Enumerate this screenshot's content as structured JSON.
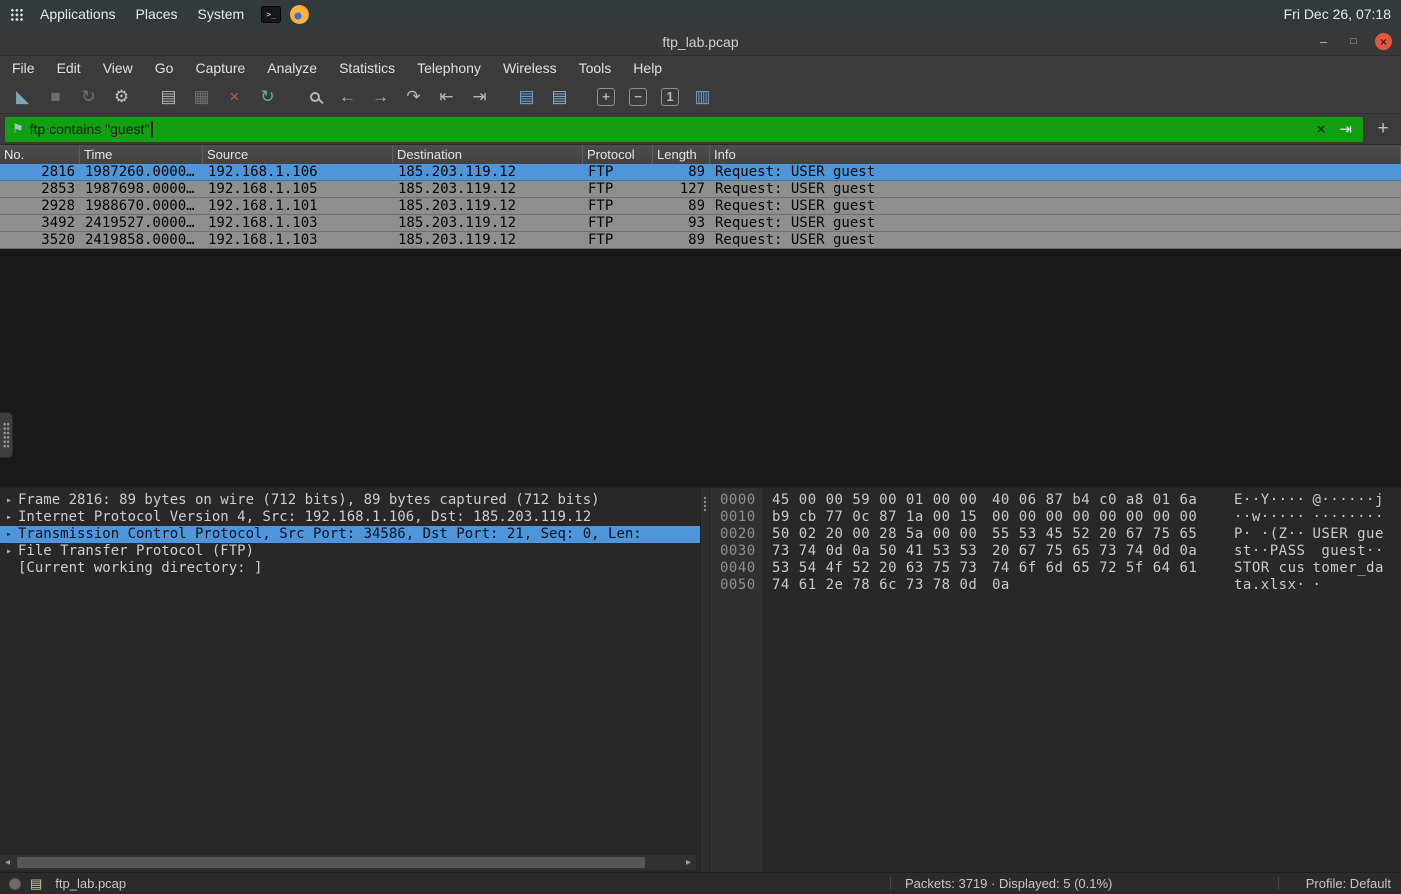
{
  "colors": {
    "filter_valid_bg": "#12a012",
    "selection_blue": "#4f95d9",
    "row_gray": "#8e8e8e",
    "close_button_orange": "#e2573d"
  },
  "panel": {
    "menus": [
      "Applications",
      "Places",
      "System"
    ],
    "launchers": [
      {
        "name": "terminal-launcher-icon",
        "glyph": ">_"
      }
    ],
    "clock": "Fri Dec 26, 07:18"
  },
  "titlebar": {
    "title": "ftp_lab.pcap",
    "buttons": [
      {
        "name": "minimize-button",
        "glyph": "–"
      },
      {
        "name": "restore-button",
        "glyph": "□"
      },
      {
        "name": "close-button",
        "glyph": "×"
      }
    ]
  },
  "menubar": {
    "items": [
      "File",
      "Edit",
      "View",
      "Go",
      "Capture",
      "Analyze",
      "Statistics",
      "Telephony",
      "Wireless",
      "Tools",
      "Help"
    ]
  },
  "toolbar": {
    "groups": [
      [
        {
          "name": "start-capture-icon",
          "glyph": "◣",
          "color": "#7fa8b8"
        },
        {
          "name": "stop-capture-icon",
          "glyph": "■",
          "color": "#6f6f6f"
        },
        {
          "name": "restart-capture-icon",
          "glyph": "↻",
          "color": "#6f6f6f"
        },
        {
          "name": "capture-options-icon",
          "glyph": "⚙",
          "color": "#b9bec2"
        }
      ],
      [
        {
          "name": "open-file-icon",
          "glyph": "▤",
          "color": "#b0b4b8"
        },
        {
          "name": "save-file-icon",
          "glyph": "▦",
          "color": "#6f6f6f"
        },
        {
          "name": "close-file-icon",
          "glyph": "×",
          "color": "#c85a50"
        },
        {
          "name": "reload-file-icon",
          "glyph": "↻",
          "color": "#5faf9f"
        }
      ],
      [
        {
          "name": "find-packet-icon",
          "shape": "magnifier",
          "color": "#b5b5b5"
        },
        {
          "name": "go-back-icon",
          "glyph": "←",
          "color": "#b5b5b5"
        },
        {
          "name": "go-forward-icon",
          "glyph": "→",
          "color": "#b5b5b5"
        },
        {
          "name": "go-to-packet-icon",
          "glyph": "↷",
          "color": "#b5b5b5"
        },
        {
          "name": "previous-packet-icon",
          "glyph": "⇤",
          "color": "#b5b5b5"
        },
        {
          "name": "next-packet-icon",
          "glyph": "⇥",
          "color": "#b5b5b5"
        }
      ],
      [
        {
          "name": "auto-scroll-icon",
          "glyph": "▤",
          "color": "#6d9fd0"
        },
        {
          "name": "colorize-packets-icon",
          "glyph": "▤",
          "color": "#7fb0d8"
        }
      ],
      [
        {
          "name": "zoom-in-icon",
          "glyph": "+",
          "color": "#b5b5b5",
          "boxed": true
        },
        {
          "name": "zoom-out-icon",
          "glyph": "−",
          "color": "#b5b5b5",
          "boxed": true
        },
        {
          "name": "normal-size-icon",
          "glyph": "1",
          "color": "#b5b5b5",
          "boxed": true
        },
        {
          "name": "resize-columns-icon",
          "glyph": "▥",
          "color": "#6d9fd0"
        }
      ]
    ]
  },
  "filter": {
    "bookmark_glyph": "⚑",
    "value": "ftp contains \"guest\"",
    "clear_glyph": "×",
    "apply_glyph": "⇥",
    "add_label": "+"
  },
  "packet_list": {
    "columns": [
      "No.",
      "Time",
      "Source",
      "Destination",
      "Protocol",
      "Length",
      "Info"
    ],
    "rows": [
      {
        "no": "2816",
        "time": "1987260.0000…",
        "source": "192.168.1.106",
        "destination": "185.203.119.12",
        "protocol": "FTP",
        "length": "89",
        "info": "Request: USER guest",
        "selected": true
      },
      {
        "no": "2853",
        "time": "1987698.0000…",
        "source": "192.168.1.105",
        "destination": "185.203.119.12",
        "protocol": "FTP",
        "length": "127",
        "info": "Request: USER guest",
        "selected": false
      },
      {
        "no": "2928",
        "time": "1988670.0000…",
        "source": "192.168.1.101",
        "destination": "185.203.119.12",
        "protocol": "FTP",
        "length": "89",
        "info": "Request: USER guest",
        "selected": false
      },
      {
        "no": "3492",
        "time": "2419527.0000…",
        "source": "192.168.1.103",
        "destination": "185.203.119.12",
        "protocol": "FTP",
        "length": "93",
        "info": "Request: USER guest",
        "selected": false
      },
      {
        "no": "3520",
        "time": "2419858.0000…",
        "source": "192.168.1.103",
        "destination": "185.203.119.12",
        "protocol": "FTP",
        "length": "89",
        "info": "Request: USER guest",
        "selected": false
      }
    ]
  },
  "details": {
    "expander_glyph": "▸",
    "lines": [
      {
        "text": "Frame 2816: 89 bytes on wire (712 bits), 89 bytes captured (712 bits)",
        "expander": true,
        "selected": false
      },
      {
        "text": "Internet Protocol Version 4, Src: 192.168.1.106, Dst: 185.203.119.12",
        "expander": true,
        "selected": false
      },
      {
        "text": "Transmission Control Protocol, Src Port: 34586, Dst Port: 21, Seq: 0, Len: ",
        "expander": true,
        "selected": true
      },
      {
        "text": "File Transfer Protocol (FTP)",
        "expander": true,
        "selected": false
      },
      {
        "text": "[Current working directory: ]",
        "expander": false,
        "selected": false
      }
    ]
  },
  "hex_dump": {
    "rows": [
      {
        "offset": "0000",
        "hex": [
          "45 00 00 59 00 01 00 00",
          "40 06 87 b4 c0 a8 01 6a"
        ],
        "ascii": [
          "E··Y····",
          "@······j"
        ]
      },
      {
        "offset": "0010",
        "hex": [
          "b9 cb 77 0c 87 1a 00 15",
          "00 00 00 00 00 00 00 00"
        ],
        "ascii": [
          "··w·····",
          "········"
        ]
      },
      {
        "offset": "0020",
        "hex": [
          "50 02 20 00 28 5a 00 00",
          "55 53 45 52 20 67 75 65"
        ],
        "ascii": [
          "P· ·(Z··",
          "USER gue"
        ]
      },
      {
        "offset": "0030",
        "hex": [
          "73 74 0d 0a 50 41 53 53",
          "20 67 75 65 73 74 0d 0a"
        ],
        "ascii": [
          "st··PASS",
          " guest··"
        ]
      },
      {
        "offset": "0040",
        "hex": [
          "53 54 4f 52 20 63 75 73",
          "74 6f 6d 65 72 5f 64 61"
        ],
        "ascii": [
          "STOR cus",
          "tomer_da"
        ]
      },
      {
        "offset": "0050",
        "hex": [
          "74 61 2e 78 6c 73 78 0d",
          "0a"
        ],
        "ascii": [
          "ta.xlsx·",
          "·"
        ]
      }
    ]
  },
  "scrollbar": {
    "left": "◂",
    "right": "▸"
  },
  "statusbar": {
    "file_label": "ftp_lab.pcap",
    "packets_label": "Packets: 3719 · Displayed: 5 (0.1%)",
    "profile_label": "Profile: Default"
  }
}
